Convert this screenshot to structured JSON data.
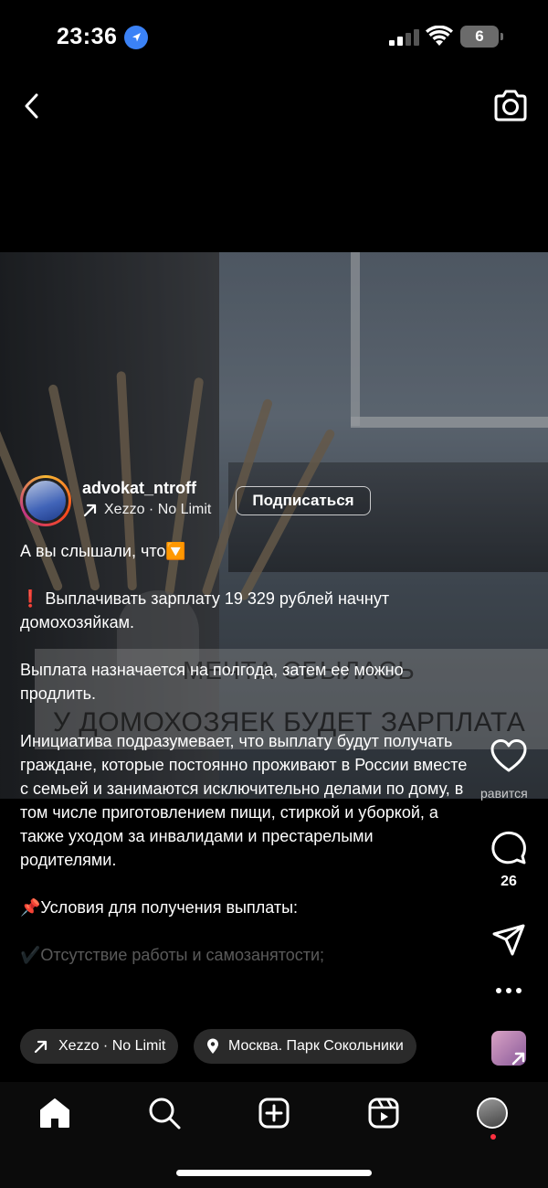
{
  "status_bar": {
    "time": "23:36",
    "battery": "6",
    "icons": [
      "location-icon",
      "signal-icon",
      "wifi-icon",
      "battery-icon"
    ]
  },
  "header": {
    "back_icon": "chevron-left-icon",
    "camera_icon": "camera-icon"
  },
  "photo_overlay": {
    "line1": "МЕЧТА СБЫЛАСЬ",
    "line2": "У ДОМОХОЗЯЕК БУДЕТ ЗАРПЛАТА"
  },
  "post": {
    "username": "advokat_ntroff",
    "music": "Xezzo · No Limit",
    "follow_label": "Подписаться",
    "caption": [
      "А вы слышали, что🔽",
      "❗️ Выплачивать зарплату 19 329 рублей начнут домохозяйкам.",
      "Выплата назначается на полгода, затем ее можно продлить.",
      "Инициатива подразумевает, что выплату будут получать граждане, которые постоянно проживают в России вместе с семьей и занимаются исключительно делами по дому, в том числе приготовлением пищи, стиркой и уборкой, а также уходом за инвалидами и престарелыми родителями.",
      "📌Условия для получения выплаты:"
    ],
    "caption_faded": "✔️Отсутствие работы и самозанятости;"
  },
  "actions": {
    "like_label": "равится",
    "comment_count": "26"
  },
  "chips": {
    "music": "Xezzo · No Limit",
    "location": "Москва. Парк Сокольники"
  },
  "nav": {
    "items": [
      "home-icon",
      "search-icon",
      "create-icon",
      "reels-icon",
      "profile-avatar"
    ]
  },
  "colors": {
    "background": "#000000",
    "chip": "#2a2a2a",
    "notification": "#ff3040",
    "location_blue": "#3b82f6"
  }
}
